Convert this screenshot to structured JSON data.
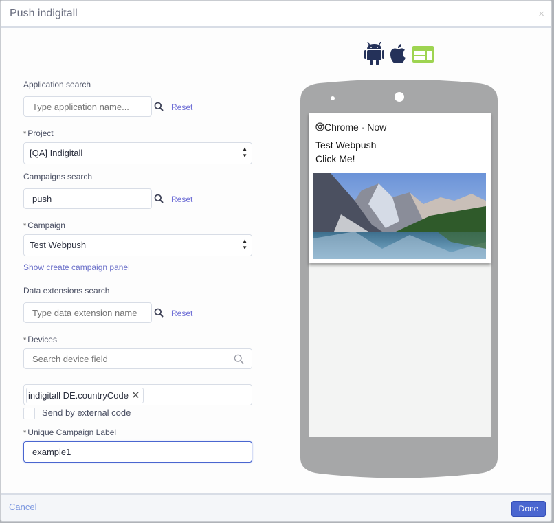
{
  "modal": {
    "title": "Push indigitall",
    "close_icon": "×"
  },
  "platform_icons": [
    "android-icon",
    "apple-icon",
    "web-icon"
  ],
  "colors": {
    "android": "#243159",
    "apple": "#243159",
    "web": "#9ed451",
    "primary_button": "#4a66d0",
    "link": "#6b70c9",
    "phone_body": "#a6a7a8"
  },
  "form": {
    "application_search": {
      "label": "Application search",
      "placeholder": "Type application name...",
      "value": "",
      "reset": "Reset"
    },
    "project": {
      "required": "*",
      "label": "Project",
      "value": "[QA] Indigitall"
    },
    "campaigns_search": {
      "label": "Campaigns search",
      "value": "push",
      "reset": "Reset"
    },
    "campaign": {
      "required": "*",
      "label": "Campaign",
      "value": "Test Webpush"
    },
    "show_create_campaign": "Show create campaign panel",
    "data_extensions_search": {
      "label": "Data extensions search",
      "placeholder": "Type data extension name",
      "value": "",
      "reset": "Reset"
    },
    "devices": {
      "required": "*",
      "label": "Devices",
      "placeholder": "Search device field",
      "selected": [
        "indigitall DE.countryCode"
      ]
    },
    "send_by_external_code": {
      "label": "Send by external code",
      "checked": false
    },
    "unique_campaign_label": {
      "required": "*",
      "label": "Unique Campaign Label",
      "value": "example1"
    }
  },
  "preview": {
    "app": "Chrome",
    "separator": "·",
    "time": "Now",
    "title": "Test Webpush",
    "body": "Click Me!",
    "image": "mountain-lake-landscape"
  },
  "footer": {
    "cancel": "Cancel",
    "done": "Done"
  }
}
